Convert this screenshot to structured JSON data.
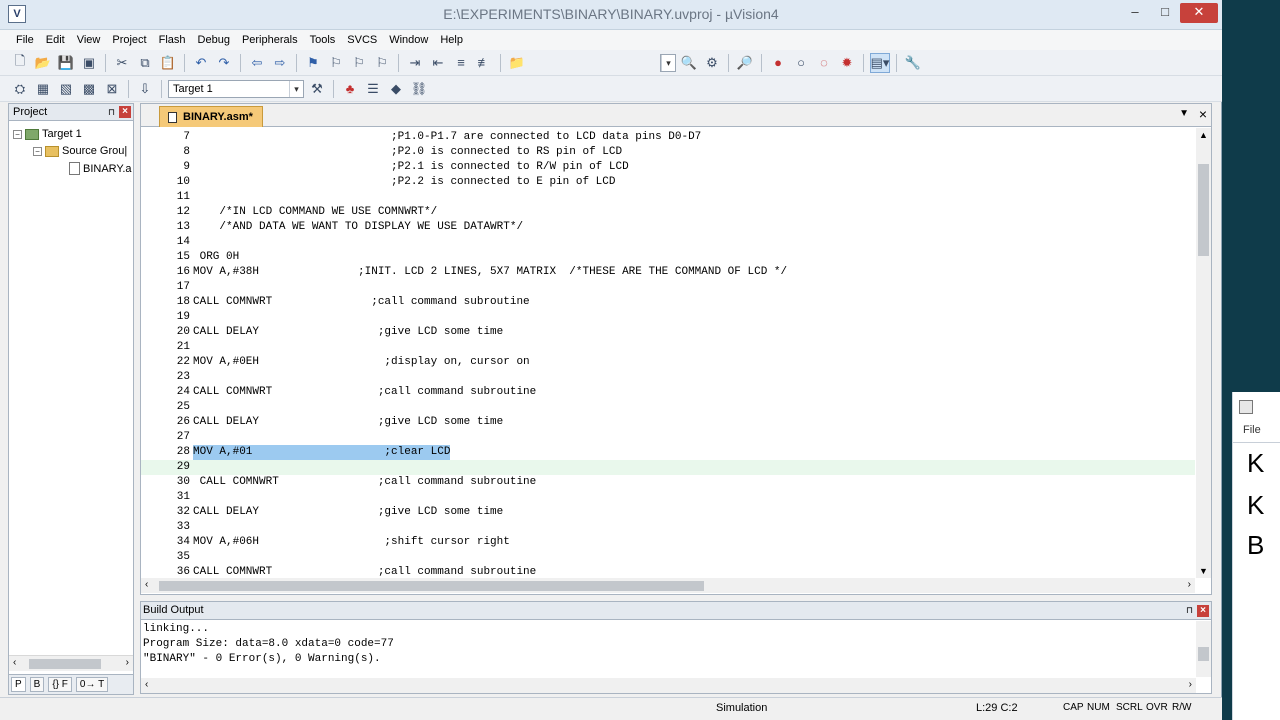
{
  "window": {
    "title": "E:\\EXPERIMENTS\\BINARY\\BINARY.uvproj - µVision4",
    "app_icon_letter": "V",
    "min": "–",
    "max": "□",
    "close": "✕"
  },
  "menu": [
    "File",
    "Edit",
    "View",
    "Project",
    "Flash",
    "Debug",
    "Peripherals",
    "Tools",
    "SVCS",
    "Window",
    "Help"
  ],
  "toolbar2": {
    "target": "Target 1"
  },
  "project_panel": {
    "title": "Project",
    "tree": [
      "Target 1",
      "Source Grou|",
      "BINARY.a"
    ],
    "tabs": [
      "P",
      "B",
      "{} F",
      "0→ T"
    ]
  },
  "editor": {
    "tab_label": "BINARY.asm*",
    "lines": [
      {
        "n": "7",
        "t": "                              ;P1.0-P1.7 are connected to LCD data pins D0-D7"
      },
      {
        "n": "8",
        "t": "                              ;P2.0 is connected to RS pin of LCD"
      },
      {
        "n": "9",
        "t": "                              ;P2.1 is connected to R/W pin of LCD"
      },
      {
        "n": "10",
        "t": "                              ;P2.2 is connected to E pin of LCD"
      },
      {
        "n": "11",
        "t": ""
      },
      {
        "n": "12",
        "t": "    /*IN LCD COMMAND WE USE COMNWRT*/"
      },
      {
        "n": "13",
        "t": "    /*AND DATA WE WANT TO DISPLAY WE USE DATAWRT*/"
      },
      {
        "n": "14",
        "t": ""
      },
      {
        "n": "15",
        "t": " ORG 0H"
      },
      {
        "n": "16",
        "t": "MOV A,#38H               ;INIT. LCD 2 LINES, 5X7 MATRIX  /*THESE ARE THE COMMAND OF LCD */"
      },
      {
        "n": "17",
        "t": ""
      },
      {
        "n": "18",
        "t": "CALL COMNWRT               ;call command subroutine"
      },
      {
        "n": "19",
        "t": ""
      },
      {
        "n": "20",
        "t": "CALL DELAY                  ;give LCD some time"
      },
      {
        "n": "21",
        "t": ""
      },
      {
        "n": "22",
        "t": "MOV A,#0EH                   ;display on, cursor on"
      },
      {
        "n": "23",
        "t": ""
      },
      {
        "n": "24",
        "t": "CALL COMNWRT                ;call command subroutine"
      },
      {
        "n": "25",
        "t": ""
      },
      {
        "n": "26",
        "t": "CALL DELAY                  ;give LCD some time"
      },
      {
        "n": "27",
        "t": ""
      },
      {
        "n": "28",
        "t": "MOV A,#01                    ;clear LCD"
      },
      {
        "n": "29",
        "t": ""
      },
      {
        "n": "30",
        "t": " CALL COMNWRT               ;call command subroutine"
      },
      {
        "n": "31",
        "t": ""
      },
      {
        "n": "32",
        "t": "CALL DELAY                  ;give LCD some time"
      },
      {
        "n": "33",
        "t": ""
      },
      {
        "n": "34",
        "t": "MOV A,#06H                   ;shift cursor right"
      },
      {
        "n": "35",
        "t": ""
      },
      {
        "n": "36",
        "t": "CALL COMNWRT                ;call command subroutine"
      }
    ]
  },
  "build": {
    "title": "Build Output",
    "lines": [
      "linking...",
      "Program Size: data=8.0 xdata=0 code=77",
      "\"BINARY\" - 0 Error(s), 0 Warning(s)."
    ]
  },
  "status": {
    "mode": "Simulation",
    "position": "L:29 C:2",
    "flags": [
      "CAP",
      "NUM",
      "SCRL",
      "OVR",
      "R/W"
    ]
  },
  "background_app": {
    "menu_label": "File",
    "letters": [
      "K",
      "K",
      "B"
    ]
  }
}
